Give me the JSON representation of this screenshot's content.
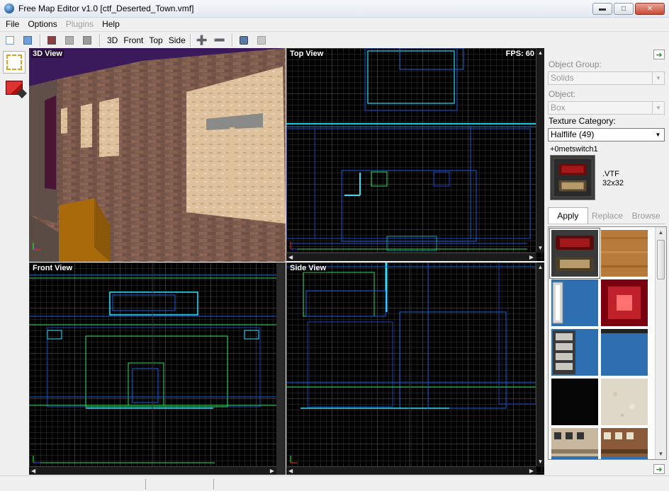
{
  "window": {
    "title": "Free Map Editor v1.0 [ctf_Deserted_Town.vmf]"
  },
  "menu": [
    {
      "label": "File",
      "disabled": false
    },
    {
      "label": "Options",
      "disabled": false
    },
    {
      "label": "Plugins",
      "disabled": true
    },
    {
      "label": "Help",
      "disabled": false
    }
  ],
  "toolbar": {
    "view_3d": "3D",
    "view_front": "Front",
    "view_top": "Top",
    "view_side": "Side"
  },
  "viewports": {
    "view3d": "3D View",
    "top": "Top View",
    "front": "Front View",
    "side": "Side View",
    "fps": "FPS: 60"
  },
  "panel": {
    "object_group_label": "Object Group:",
    "object_group_value": "Solids",
    "object_label": "Object:",
    "object_value": "Box",
    "texture_category_label": "Texture Category:",
    "texture_category_value": "Halflife (49)",
    "texture_name": "+0metswitch1",
    "texture_format": ".VTF",
    "texture_size": "32x32",
    "apply": "Apply",
    "replace": "Replace",
    "browse": "Browse"
  },
  "textures": [
    {
      "name": "switch",
      "color": "#3a3a3a"
    },
    {
      "name": "wood",
      "color": "#b87a3a"
    },
    {
      "name": "light-tube",
      "color": "#2d6fb0"
    },
    {
      "name": "red-light",
      "color": "#c0202a"
    },
    {
      "name": "vent",
      "color": "#2d6fb0"
    },
    {
      "name": "blue",
      "color": "#2d6fb0"
    },
    {
      "name": "black",
      "color": "#050505"
    },
    {
      "name": "plaster",
      "color": "#ddd8c8"
    },
    {
      "name": "building-a",
      "color": "#c8b8a0"
    },
    {
      "name": "building-b",
      "color": "#8a5a3a"
    }
  ]
}
